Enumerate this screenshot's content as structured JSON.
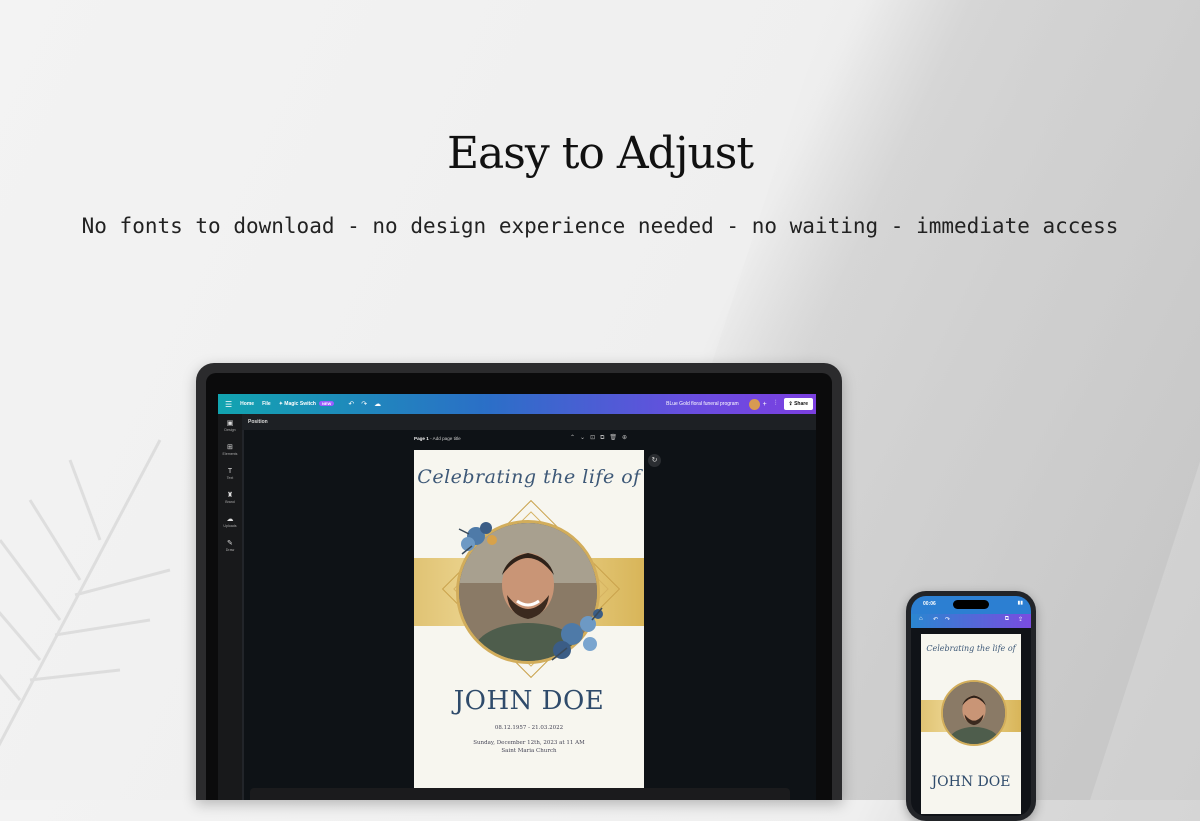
{
  "promo": {
    "headline": "Easy to Adjust",
    "subline": "No fonts to download - no design experience needed - no waiting - immediate access"
  },
  "editor": {
    "menu_icon": "hamburger-icon",
    "home_label": "Home",
    "file_label": "File",
    "magic_label": "Magic Switch",
    "magic_badge": "NEW",
    "doc_title": "BLue Gold floral funeral program",
    "share_label": "Share",
    "position_label": "Position",
    "page_label_bold": "Page 1",
    "page_label_rest": " - Add page title",
    "sidebar": [
      {
        "icon": "▣",
        "label": "Design"
      },
      {
        "icon": "⊞",
        "label": "Elements"
      },
      {
        "icon": "T",
        "label": "Text"
      },
      {
        "icon": "♜",
        "label": "Brand"
      },
      {
        "icon": "☁",
        "label": "Uploads"
      },
      {
        "icon": "✎",
        "label": "Draw"
      }
    ],
    "accent_colors": [
      "#12a4b0",
      "#2b6fc7",
      "#7b3fe0"
    ]
  },
  "design": {
    "script_title": "Celebrating the life of",
    "name": "JOHN DOE",
    "dates": "08.12.1957 - 21.03.2022",
    "when": "Sunday, December 12th, 2023 at 11 AM",
    "where": "Saint Maria Church",
    "name_color": "#2f4b6b",
    "band_color": "#e0c374"
  },
  "phone": {
    "time": "00:06",
    "script_title": "Celebrating the life of",
    "name": "JOHN DOE"
  }
}
